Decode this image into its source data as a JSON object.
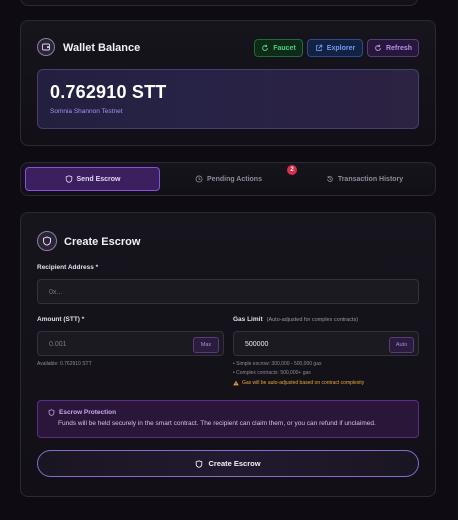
{
  "wallet": {
    "title": "Wallet Balance",
    "faucet_label": "Faucet",
    "explorer_label": "Explorer",
    "refresh_label": "Refresh",
    "balance": "0.762910 STT",
    "network": "Somnia Shannon Testnet"
  },
  "tabs": {
    "send": "Send Escrow",
    "pending": "Pending Actions",
    "pending_count": "2",
    "history": "Transaction History"
  },
  "escrow": {
    "title": "Create Escrow",
    "recipient_label": "Recipient Address *",
    "recipient_placeholder": "0x...",
    "amount_label": "Amount (STT) *",
    "amount_placeholder": "0.001",
    "max_label": "Max",
    "available": "Available: 0.762910 STT",
    "gas_label": "Gas Limit",
    "gas_sublabel": "(Auto-adjusted for complex contracts)",
    "gas_value": "500000",
    "auto_label": "Auto",
    "gas_hint_simple": "• Simple escrow: 300,000 - 500,000 gas",
    "gas_hint_complex": "• Complex contracts: 500,000+ gas",
    "gas_warning": "Gas will be auto-adjusted based on contract complexity",
    "protection_title": "Escrow Protection",
    "protection_text": "Funds will be held securely in the smart contract. The recipient can claim them, or you can refund if unclaimed.",
    "create_button": "Create Escrow"
  },
  "colors": {
    "accent": "#8a4ee0",
    "faucet": "#4ad07a",
    "explorer": "#6e9cf0",
    "refresh": "#c08af0",
    "warning": "#e9a83a",
    "badge": "#d8304a"
  }
}
